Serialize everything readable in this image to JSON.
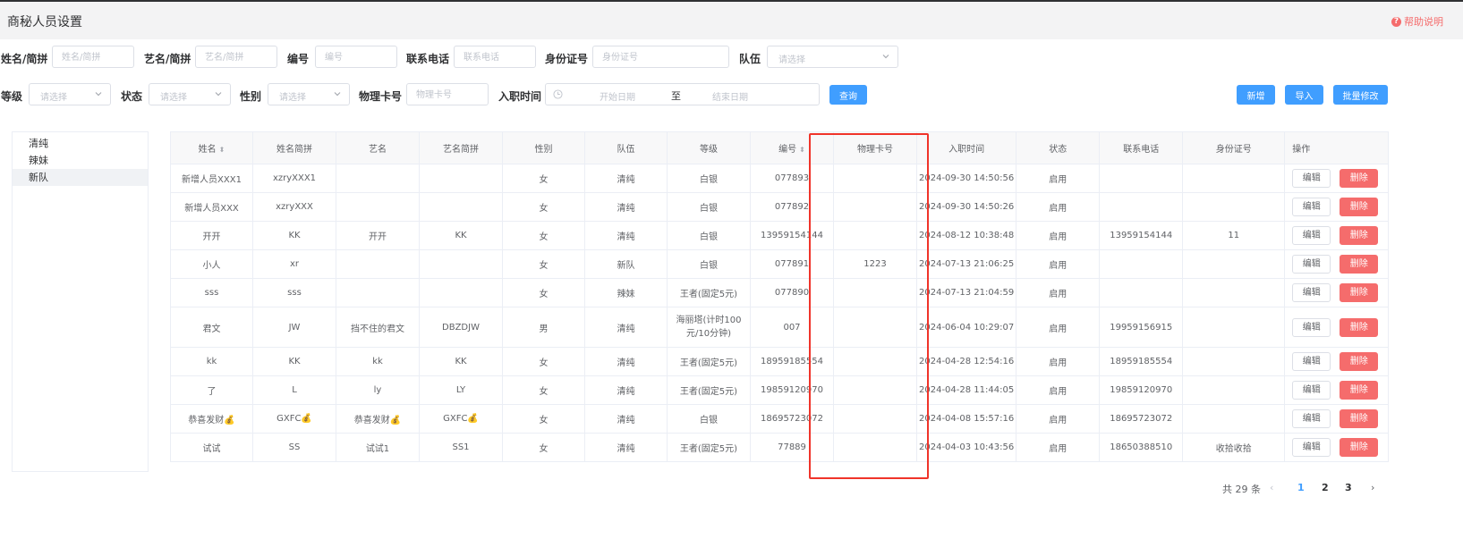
{
  "header": {
    "title": "商秘人员设置",
    "help_label": "帮助说明",
    "help_icon": "question-circle-icon"
  },
  "filters": {
    "name": {
      "label": "姓名/简拼",
      "placeholder": "姓名/简拼"
    },
    "stage_name": {
      "label": "艺名/简拼",
      "placeholder": "艺名/简拼"
    },
    "number": {
      "label": "编号",
      "placeholder": "编号"
    },
    "phone": {
      "label": "联系电话",
      "placeholder": "联系电话"
    },
    "id_card": {
      "label": "身份证号",
      "placeholder": "身份证号"
    },
    "team": {
      "label": "队伍",
      "placeholder": "请选择"
    },
    "level": {
      "label": "等级",
      "placeholder": "请选择"
    },
    "status": {
      "label": "状态",
      "placeholder": "请选择"
    },
    "gender": {
      "label": "性别",
      "placeholder": "请选择"
    },
    "card": {
      "label": "物理卡号",
      "placeholder": "物理卡号"
    },
    "hire_date": {
      "label": "入职时间",
      "start": "开始日期",
      "separator": "至",
      "end": "结束日期"
    }
  },
  "buttons": {
    "query": "查询",
    "add": "新增",
    "import": "导入",
    "batch_edit": "批量修改"
  },
  "teams": [
    "清纯",
    "辣妹",
    "新队"
  ],
  "active_team": "新队",
  "table": {
    "columns": [
      "姓名",
      "姓名简拼",
      "艺名",
      "艺名简拼",
      "性别",
      "队伍",
      "等级",
      "编号",
      "物理卡号",
      "入职时间",
      "状态",
      "联系电话",
      "身份证号",
      "操作"
    ],
    "edit_label": "编辑",
    "delete_label": "删除",
    "rows": [
      [
        "新增人员XXX1",
        "xzryXXX1",
        "",
        "",
        "女",
        "清纯",
        "白银",
        "077893",
        "",
        "2024-09-30 14:50:56",
        "启用",
        "",
        ""
      ],
      [
        "新增人员XXX",
        "xzryXXX",
        "",
        "",
        "女",
        "清纯",
        "白银",
        "077892",
        "",
        "2024-09-30 14:50:26",
        "启用",
        "",
        ""
      ],
      [
        "开开",
        "KK",
        "开开",
        "KK",
        "女",
        "清纯",
        "白银",
        "13959154144",
        "",
        "2024-08-12 10:38:48",
        "启用",
        "13959154144",
        "11"
      ],
      [
        "小人",
        "xr",
        "",
        "",
        "女",
        "新队",
        "白银",
        "077891",
        "1223",
        "2024-07-13 21:06:25",
        "启用",
        "",
        ""
      ],
      [
        "sss",
        "sss",
        "",
        "",
        "女",
        "辣妹",
        "王者(固定5元)",
        "077890",
        "",
        "2024-07-13 21:04:59",
        "启用",
        "",
        ""
      ],
      [
        "君文",
        "JW",
        "挡不住的君文",
        "DBZDJW",
        "男",
        "清纯",
        "海丽塔(计时100元/10分钟)",
        "007",
        "",
        "2024-06-04 10:29:07",
        "启用",
        "19959156915",
        ""
      ],
      [
        "kk",
        "KK",
        "kk",
        "KK",
        "女",
        "清纯",
        "王者(固定5元)",
        "18959185554",
        "",
        "2024-04-28 12:54:16",
        "启用",
        "18959185554",
        ""
      ],
      [
        "了",
        "L",
        "ly",
        "LY",
        "女",
        "清纯",
        "王者(固定5元)",
        "19859120970",
        "",
        "2024-04-28 11:44:05",
        "启用",
        "19859120970",
        ""
      ],
      [
        "恭喜发财💰",
        "GXFC💰",
        "恭喜发财💰",
        "GXFC💰",
        "女",
        "清纯",
        "白银",
        "18695723072",
        "",
        "2024-04-08 15:57:16",
        "启用",
        "18695723072",
        ""
      ],
      [
        "试试",
        "SS",
        "试试1",
        "SS1",
        "女",
        "清纯",
        "王者(固定5元)",
        "77889",
        "",
        "2024-04-03 10:43:56",
        "启用",
        "18650388510",
        "收拾收拾"
      ]
    ]
  },
  "pagination": {
    "total": "共 29 条",
    "pages": [
      "1",
      "2",
      "3"
    ],
    "current": "1",
    "prev_icon": "chevron-left-icon",
    "next_icon": "chevron-right-icon"
  },
  "colors": {
    "primary": "#409eff",
    "danger": "#f56c6c",
    "highlight": "#f0342a"
  }
}
